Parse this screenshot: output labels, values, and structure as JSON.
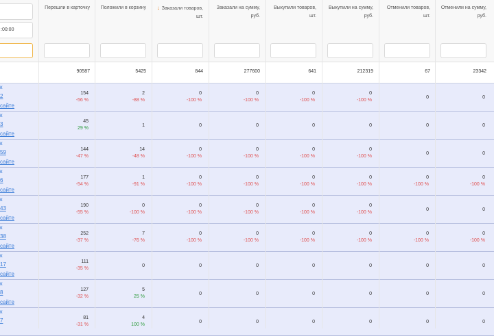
{
  "left_panel": {
    "date_input": ":00:00"
  },
  "columns": [
    {
      "title": "Перешли в карточку"
    },
    {
      "title": "Положили в корзину"
    },
    {
      "title": "Заказали товаров, шт.",
      "sorted": true,
      "sort_icon": "sort-desc-icon"
    },
    {
      "title": "Заказали на сумму, руб."
    },
    {
      "title": "Выкупили товаров, шт."
    },
    {
      "title": "Выкупили на сумму, руб."
    },
    {
      "title": "Отменили товаров, шт."
    },
    {
      "title": "Отменили на сумму, руб."
    }
  ],
  "totals": [
    "90587",
    "5425",
    "844",
    "277600",
    "641",
    "212319",
    "67",
    "23342"
  ],
  "rows": [
    {
      "label": [
        "к",
        "2",
        "сайте"
      ],
      "cells": [
        [
          "154",
          "-56 %"
        ],
        [
          "2",
          "-88 %"
        ],
        [
          "0",
          "-100 %"
        ],
        [
          "0",
          "-100 %"
        ],
        [
          "0",
          "-100 %"
        ],
        [
          "0",
          "-100 %"
        ],
        [
          "0",
          ""
        ],
        [
          "0",
          ""
        ]
      ]
    },
    {
      "label": [
        "к",
        "3",
        "сайте"
      ],
      "cells": [
        [
          "45",
          "29 %"
        ],
        [
          "1",
          ""
        ],
        [
          "0",
          ""
        ],
        [
          "0",
          ""
        ],
        [
          "0",
          ""
        ],
        [
          "0",
          ""
        ],
        [
          "0",
          ""
        ],
        [
          "0",
          ""
        ]
      ]
    },
    {
      "label": [
        "к",
        "59",
        "сайте"
      ],
      "cells": [
        [
          "144",
          "-47 %"
        ],
        [
          "14",
          "-48 %"
        ],
        [
          "0",
          "-100 %"
        ],
        [
          "0",
          "-100 %"
        ],
        [
          "0",
          "-100 %"
        ],
        [
          "0",
          "-100 %"
        ],
        [
          "0",
          ""
        ],
        [
          "0",
          ""
        ]
      ]
    },
    {
      "label": [
        "к",
        "6",
        "сайте"
      ],
      "cells": [
        [
          "177",
          "-54 %"
        ],
        [
          "1",
          "-91 %"
        ],
        [
          "0",
          "-100 %"
        ],
        [
          "0",
          "-100 %"
        ],
        [
          "0",
          "-100 %"
        ],
        [
          "0",
          "-100 %"
        ],
        [
          "0",
          "-100 %"
        ],
        [
          "0",
          "-100 %"
        ]
      ]
    },
    {
      "label": [
        "к",
        "43",
        "сайте"
      ],
      "cells": [
        [
          "190",
          "-55 %"
        ],
        [
          "0",
          "-100 %"
        ],
        [
          "0",
          "-100 %"
        ],
        [
          "0",
          "-100 %"
        ],
        [
          "0",
          "-100 %"
        ],
        [
          "0",
          "-100 %"
        ],
        [
          "0",
          ""
        ],
        [
          "0",
          ""
        ]
      ]
    },
    {
      "label": [
        "к",
        "38",
        "сайте"
      ],
      "cells": [
        [
          "252",
          "-37 %"
        ],
        [
          "7",
          "-76 %"
        ],
        [
          "0",
          "-100 %"
        ],
        [
          "0",
          "-100 %"
        ],
        [
          "0",
          "-100 %"
        ],
        [
          "0",
          "-100 %"
        ],
        [
          "0",
          "-100 %"
        ],
        [
          "0",
          "-100 %"
        ]
      ]
    },
    {
      "label": [
        "к",
        "17",
        "сайте"
      ],
      "cells": [
        [
          "111",
          "-35 %"
        ],
        [
          "0",
          ""
        ],
        [
          "0",
          ""
        ],
        [
          "0",
          ""
        ],
        [
          "0",
          ""
        ],
        [
          "0",
          ""
        ],
        [
          "0",
          ""
        ],
        [
          "0",
          ""
        ]
      ]
    },
    {
      "label": [
        "к",
        "8",
        "сайте"
      ],
      "cells": [
        [
          "127",
          "-32 %"
        ],
        [
          "5",
          "25 %"
        ],
        [
          "0",
          ""
        ],
        [
          "0",
          ""
        ],
        [
          "0",
          ""
        ],
        [
          "0",
          ""
        ],
        [
          "0",
          ""
        ],
        [
          "0",
          ""
        ]
      ]
    },
    {
      "label": [
        "к",
        "7",
        ""
      ],
      "cells": [
        [
          "81",
          "-31 %"
        ],
        [
          "4",
          "100 %"
        ],
        [
          "0",
          ""
        ],
        [
          "0",
          ""
        ],
        [
          "0",
          ""
        ],
        [
          "0",
          ""
        ],
        [
          "0",
          ""
        ],
        [
          "0",
          ""
        ]
      ]
    }
  ],
  "colors": {
    "row_bg": "#e8ebfb",
    "negative": "#e05050",
    "positive": "#2a9a3a",
    "link": "#3b7dd8",
    "sort_arrow": "#e67e22"
  }
}
